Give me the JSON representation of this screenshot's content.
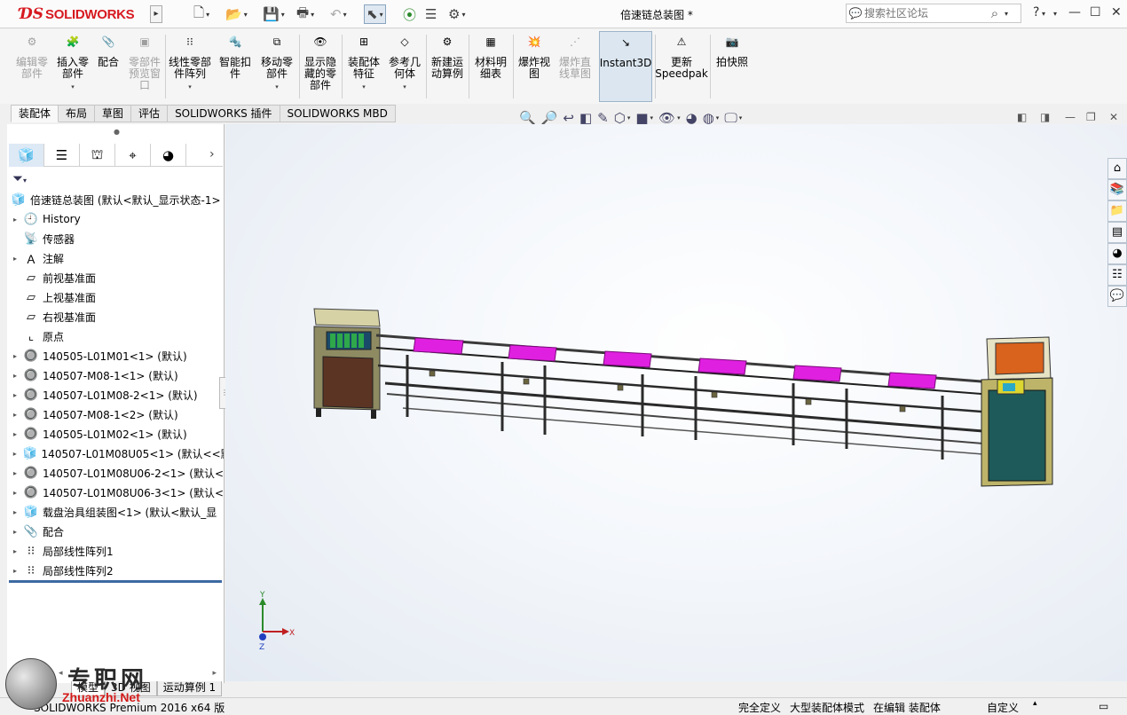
{
  "app": {
    "brand": "SOLIDWORKS",
    "doc_title": "倍速链总装图 *"
  },
  "search": {
    "placeholder": "搜索社区论坛"
  },
  "command_manager": {
    "buttons": [
      {
        "label": "编辑零\n部件",
        "enabled": false
      },
      {
        "label": "插入零\n部件",
        "enabled": true
      },
      {
        "label": "配合",
        "enabled": true
      },
      {
        "label": "零部件\n预览窗\n口",
        "enabled": false
      },
      {
        "label": "线性零部\n件阵列",
        "enabled": true
      },
      {
        "label": "智能扣\n件",
        "enabled": true
      },
      {
        "label": "移动零\n部件",
        "enabled": true
      },
      {
        "label": "显示隐\n藏的零\n部件",
        "enabled": true
      },
      {
        "label": "装配体\n特征",
        "enabled": true
      },
      {
        "label": "参考几\n何体",
        "enabled": true
      },
      {
        "label": "新建运\n动算例",
        "enabled": true
      },
      {
        "label": "材料明\n细表",
        "enabled": true
      },
      {
        "label": "爆炸视\n图",
        "enabled": true
      },
      {
        "label": "爆炸直\n线草图",
        "enabled": false
      },
      {
        "label": "Instant3D",
        "enabled": true
      },
      {
        "label": "更新\nSpeedpak",
        "enabled": true
      },
      {
        "label": "拍快照",
        "enabled": true
      }
    ],
    "tabs": [
      "装配体",
      "布局",
      "草图",
      "评估",
      "SOLIDWORKS 插件",
      "SOLIDWORKS MBD"
    ]
  },
  "feature_tree": {
    "root": "倍速链总装图  (默认<默认_显示状态-1>",
    "nodes": [
      {
        "label": "History",
        "icon": "history-folder-icon",
        "expandable": true
      },
      {
        "label": "传感器",
        "icon": "sensor-icon",
        "expandable": false
      },
      {
        "label": "注解",
        "icon": "annotation-icon",
        "expandable": true
      },
      {
        "label": "前视基准面",
        "icon": "plane-icon",
        "expandable": false
      },
      {
        "label": "上视基准面",
        "icon": "plane-icon",
        "expandable": false
      },
      {
        "label": "右视基准面",
        "icon": "plane-icon",
        "expandable": false
      },
      {
        "label": "原点",
        "icon": "origin-icon",
        "expandable": false
      },
      {
        "label": "140505-L01M01<1> (默认)",
        "icon": "part-icon",
        "expandable": true
      },
      {
        "label": "140507-M08-1<1> (默认)",
        "icon": "part-icon",
        "expandable": true
      },
      {
        "label": "140507-L01M08-2<1> (默认)",
        "icon": "part-icon",
        "expandable": true
      },
      {
        "label": "140507-M08-1<2> (默认)",
        "icon": "part-icon",
        "expandable": true
      },
      {
        "label": "140505-L01M02<1> (默认)",
        "icon": "part-icon",
        "expandable": true
      },
      {
        "label": "140507-L01M08U05<1> (默认<<默",
        "icon": "subassembly-icon",
        "expandable": true
      },
      {
        "label": "140507-L01M08U06-2<1> (默认<",
        "icon": "part-icon",
        "expandable": true
      },
      {
        "label": "140507-L01M08U06-3<1> (默认<",
        "icon": "part-icon",
        "expandable": true
      },
      {
        "label": "载盘治具组装图<1> (默认<默认_显",
        "icon": "subassembly-icon",
        "expandable": true
      },
      {
        "label": "配合",
        "icon": "mates-icon",
        "expandable": true
      },
      {
        "label": "局部线性阵列1",
        "icon": "pattern-icon",
        "expandable": true
      },
      {
        "label": "局部线性阵列2",
        "icon": "pattern-icon",
        "expandable": true
      }
    ]
  },
  "bottom_tabs": [
    "模型",
    "3D 视图",
    "运动算例 1"
  ],
  "status_bar": {
    "product": "SOLIDWORKS Premium 2016 x64 版",
    "fully_defined": "完全定义",
    "large_assembly": "大型装配体模式",
    "editing": "在编辑 装配体",
    "units": "自定义"
  },
  "triad": {
    "x": "X",
    "y": "Y",
    "z": "Z"
  },
  "watermark": {
    "cn": "专职网",
    "en": "Zhuanzhi.Net"
  },
  "colors": {
    "brand_red": "#d71920",
    "tray_magenta": "#e020e0",
    "cabinet_teal": "#1f5a5a",
    "cabinet_brown": "#5c3424",
    "panel_orange": "#d9621c",
    "selection_blue": "#3d6aa1"
  }
}
